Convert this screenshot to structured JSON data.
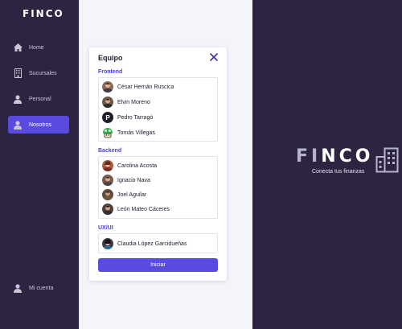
{
  "sidebar": {
    "logo": "FINCO",
    "items": [
      {
        "label": "Home",
        "icon": "home-icon"
      },
      {
        "label": "Sucursales",
        "icon": "building-icon"
      },
      {
        "label": "Personal",
        "icon": "person-icon"
      },
      {
        "label": "Nosotros",
        "icon": "team-icon",
        "active": true
      }
    ],
    "account": {
      "label": "Mi cuenta",
      "icon": "user-account-icon"
    }
  },
  "modal": {
    "title": "Equipo",
    "close_icon": "close-icon",
    "sections": [
      {
        "label": "Frontend",
        "members": [
          "César Hernán Ruscica",
          "Elvin Moreno",
          "Pedro Tarragó",
          "Tomás Villegas"
        ]
      },
      {
        "label": "Backend",
        "members": [
          "Carolina Acosta",
          "Ignacio Nava",
          "Joel Aguilar",
          "León Mateo Cáceres"
        ]
      },
      {
        "label": "UX/UI",
        "members": [
          "Claudia López Garcidueñas"
        ]
      }
    ],
    "start_button": "Iniciar"
  },
  "brand": {
    "name_fi": "FI",
    "name_rest": "NCO",
    "tagline": "Conecta tus finanzas"
  },
  "colors": {
    "sidebar_bg": "#2d2442",
    "accent": "#5a4be0",
    "section_label": "#4b3dd6"
  }
}
